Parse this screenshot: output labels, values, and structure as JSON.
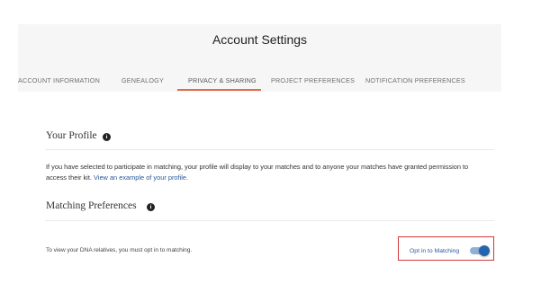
{
  "header": {
    "title": "Account Settings",
    "tabs": [
      {
        "label": "ACCOUNT INFORMATION"
      },
      {
        "label": "GENEALOGY"
      },
      {
        "label": "PRIVACY & SHARING"
      },
      {
        "label": "PROJECT PREFERENCES"
      },
      {
        "label": "NOTIFICATION PREFERENCES"
      }
    ],
    "active_tab": "PRIVACY & SHARING"
  },
  "your_profile": {
    "title": "Your Profile",
    "text": "If you have selected to participate in matching, your profile will display to your matches and to anyone your matches have granted permission to access their kit.",
    "link": "View an example of your profile."
  },
  "matching_preferences": {
    "title": "Matching Preferences",
    "note": "To view your DNA relatives, you must opt in to matching.",
    "optin_label": "Opt in to Matching",
    "optin_enabled": true
  },
  "colors": {
    "accent": "#e26a4a",
    "link": "#2a5a9a",
    "toggle": "#2565ad",
    "highlight_box": "#d2383a"
  },
  "icons": [
    "info-icon"
  ]
}
